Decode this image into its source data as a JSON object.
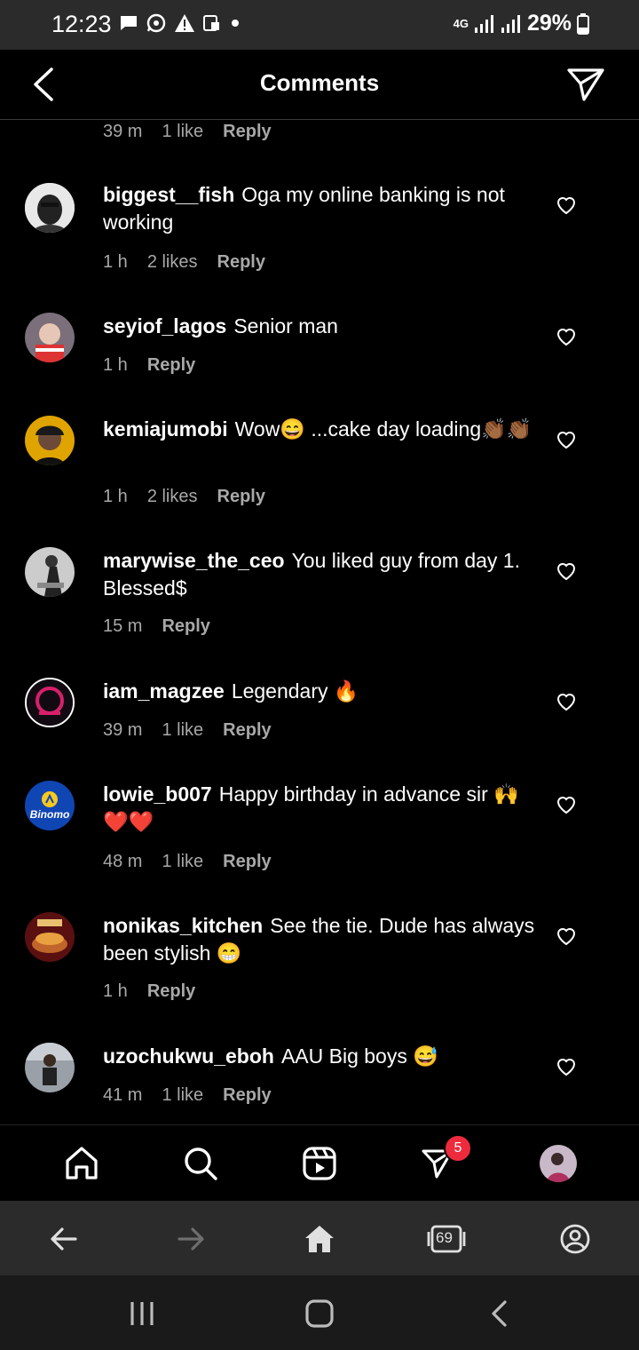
{
  "status": {
    "time": "12:23",
    "network": "4G",
    "battery": "29%"
  },
  "header": {
    "title": "Comments"
  },
  "top_partial": {
    "time": "39 m",
    "likes": "1 like",
    "reply": "Reply"
  },
  "comments": [
    {
      "user": "biggest__fish",
      "text": "Oga my online banking is not working",
      "time": "1 h",
      "likes": "2 likes",
      "reply": "Reply"
    },
    {
      "user": "seyiof_lagos",
      "text": "Senior man",
      "time": "1 h",
      "likes": "",
      "reply": "Reply"
    },
    {
      "user": "kemiajumobi",
      "text": "Wow😄 ...cake day loading👏🏾👏🏾",
      "time": "1 h",
      "likes": "2 likes",
      "reply": "Reply"
    },
    {
      "user": "marywise_the_ceo",
      "text": "You liked guy from day 1. Blessed$",
      "time": "15 m",
      "likes": "",
      "reply": "Reply"
    },
    {
      "user": "iam_magzee",
      "text": "Legendary 🔥",
      "time": "39 m",
      "likes": "1 like",
      "reply": "Reply"
    },
    {
      "user": "lowie_b007",
      "text": "Happy birthday in advance sir 🙌❤️❤️",
      "time": "48 m",
      "likes": "1 like",
      "reply": "Reply",
      "avatar_label": "Binomo"
    },
    {
      "user": "nonikas_kitchen",
      "text": "See the tie. Dude has always been stylish 😁",
      "time": "1 h",
      "likes": "",
      "reply": "Reply"
    },
    {
      "user": "uzochukwu_eboh",
      "text": "AAU Big boys 😅",
      "time": "41 m",
      "likes": "1 like",
      "reply": "Reply"
    }
  ],
  "nav": {
    "badge_count": "5"
  },
  "browser": {
    "tabs_count": "69"
  },
  "colors": {
    "background": "#000000",
    "meta_text": "#a8a8a8",
    "badge": "#ed2b3d"
  }
}
